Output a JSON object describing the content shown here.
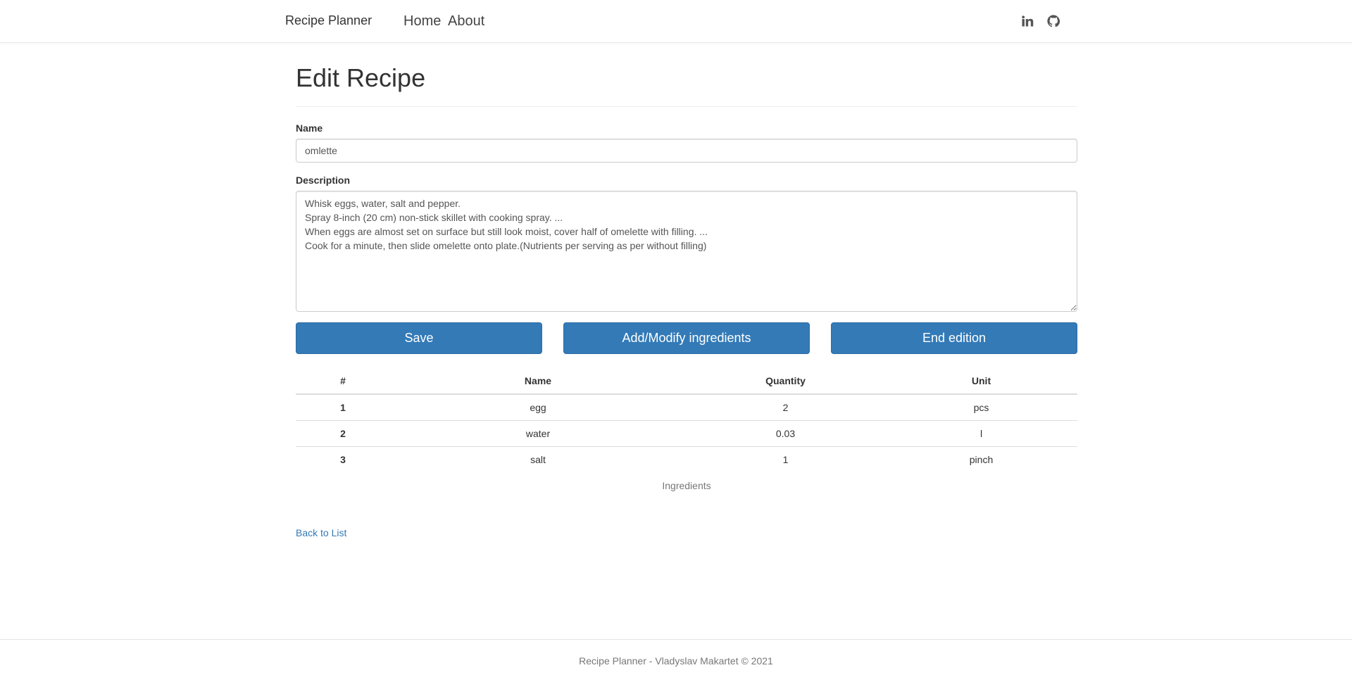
{
  "navbar": {
    "brand": "Recipe Planner",
    "links": [
      {
        "label": "Home"
      },
      {
        "label": "About"
      }
    ],
    "social_icons": [
      "linkedin-icon",
      "github-icon"
    ]
  },
  "page": {
    "title": "Edit Recipe"
  },
  "form": {
    "name_label": "Name",
    "name_value": "omlette",
    "description_label": "Description",
    "description_value": "Whisk eggs, water, salt and pepper.\nSpray 8-inch (20 cm) non-stick skillet with cooking spray. ...\nWhen eggs are almost set on surface but still look moist, cover half of omelette with filling. ...\nCook for a minute, then slide omelette onto plate.(Nutrients per serving as per without filling)"
  },
  "actions": {
    "save": "Save",
    "modify_ingredients": "Add/Modify ingredients",
    "end_edition": "End edition"
  },
  "ingredients": {
    "headers": [
      "#",
      "Name",
      "Quantity",
      "Unit"
    ],
    "rows": [
      [
        "1",
        "egg",
        "2",
        "pcs"
      ],
      [
        "2",
        "water",
        "0.03",
        "l"
      ],
      [
        "3",
        "salt",
        "1",
        "pinch"
      ]
    ],
    "caption": "Ingredients"
  },
  "back_link": "Back to List",
  "footer": {
    "text": "Recipe Planner - Vladyslav Makartet © 2021"
  },
  "colors": {
    "primary": "#337ab7",
    "link": "#337ab7",
    "muted": "#777777"
  }
}
